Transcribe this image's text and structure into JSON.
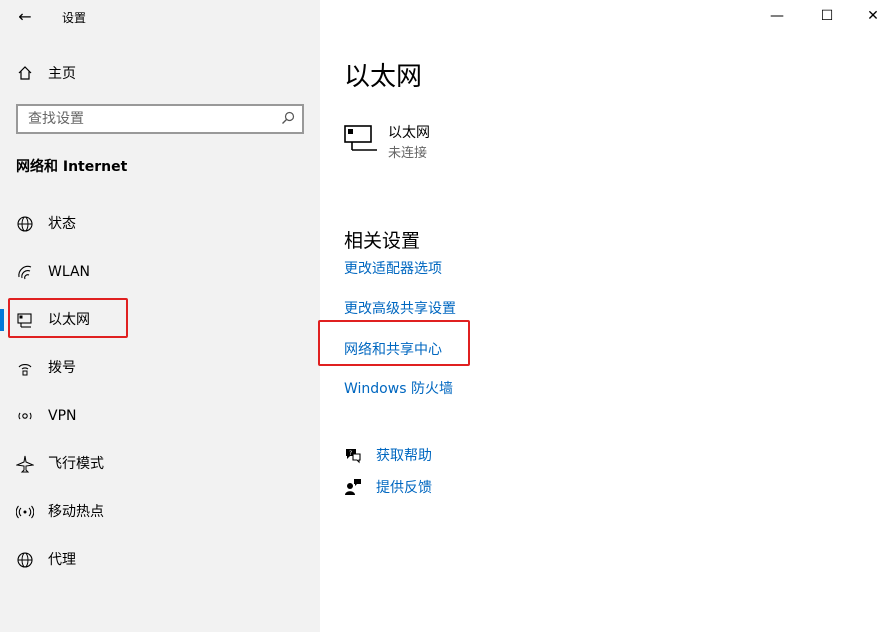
{
  "window": {
    "title": "设置",
    "back_icon": "←",
    "controls": {
      "minimize": "—",
      "maximize": "☐",
      "close": "✕"
    }
  },
  "sidebar": {
    "home_label": "主页",
    "search_placeholder": "查找设置",
    "section_title": "网络和 Internet",
    "items": [
      {
        "label": "状态",
        "icon": "status-globe-icon"
      },
      {
        "label": "WLAN",
        "icon": "wifi-icon"
      },
      {
        "label": "以太网",
        "icon": "ethernet-icon",
        "active": true
      },
      {
        "label": "拨号",
        "icon": "dialup-icon"
      },
      {
        "label": "VPN",
        "icon": "vpn-icon"
      },
      {
        "label": "飞行模式",
        "icon": "airplane-icon"
      },
      {
        "label": "移动热点",
        "icon": "hotspot-icon"
      },
      {
        "label": "代理",
        "icon": "proxy-globe-icon"
      }
    ]
  },
  "main": {
    "page_title": "以太网",
    "ethernet": {
      "name": "以太网",
      "status": "未连接"
    },
    "related_title": "相关设置",
    "related_links": [
      "更改适配器选项",
      "更改高级共享设置",
      "网络和共享中心",
      "Windows 防火墙"
    ],
    "help": [
      {
        "label": "获取帮助",
        "icon": "help-chat-icon"
      },
      {
        "label": "提供反馈",
        "icon": "feedback-icon"
      }
    ]
  },
  "colors": {
    "accent": "#0078d7",
    "link": "#0067c0",
    "highlight_box": "#e02020",
    "sidebar_bg": "#f2f2f2"
  }
}
